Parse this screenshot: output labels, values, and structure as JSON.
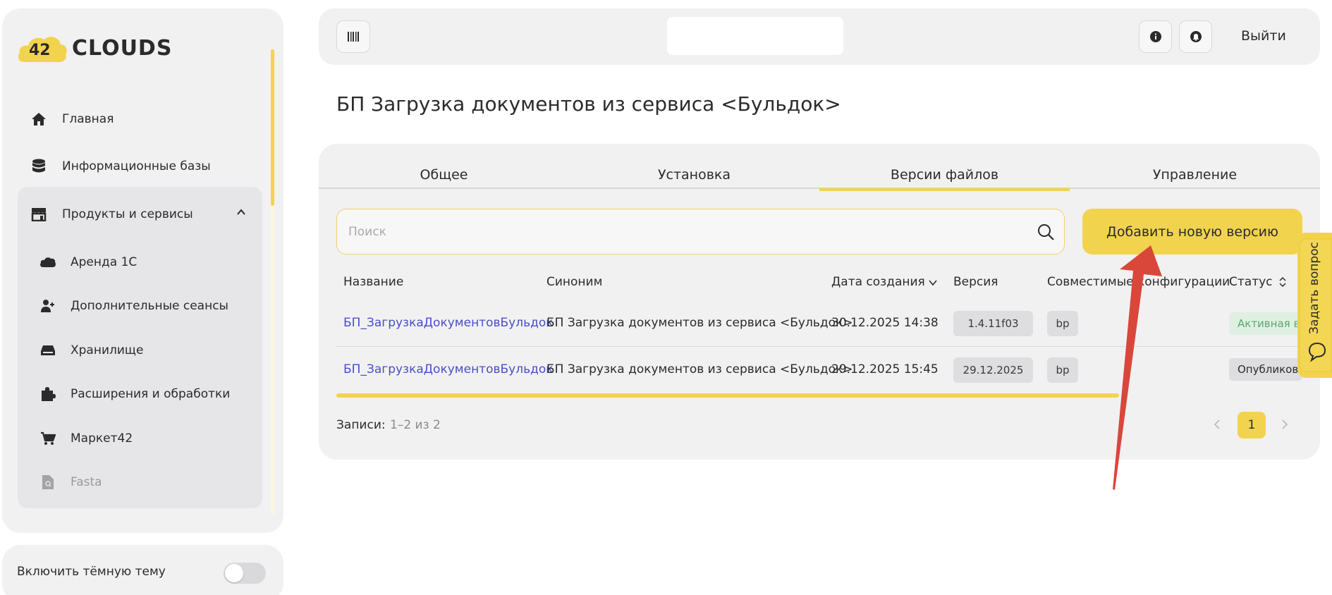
{
  "brand": {
    "logo_number": "42",
    "logo_text": "CLOUDS"
  },
  "sidebar": {
    "items": [
      {
        "label": "Главная",
        "icon": "home-icon"
      },
      {
        "label": "Информационные базы",
        "icon": "database-icon"
      },
      {
        "label": "Продукты и сервисы",
        "icon": "store-icon"
      }
    ],
    "sub_items": [
      {
        "label": "Аренда 1С",
        "icon": "cloud-icon"
      },
      {
        "label": "Дополнительные сеансы",
        "icon": "user-plus-icon"
      },
      {
        "label": "Хранилище",
        "icon": "storage-icon"
      },
      {
        "label": "Расширения и обработки",
        "icon": "puzzle-icon"
      },
      {
        "label": "Маркет42",
        "icon": "cart-icon"
      },
      {
        "label": "Fasta",
        "icon": "file-search-icon"
      }
    ],
    "theme_label": "Включить тёмную тему",
    "theme_enabled": false
  },
  "topbar": {
    "logout_label": "Выйти"
  },
  "page": {
    "title": "БП Загрузка документов из сервиса <Бульдок>"
  },
  "tabs": [
    {
      "label": "Общее",
      "active": false
    },
    {
      "label": "Установка",
      "active": false
    },
    {
      "label": "Версии файлов",
      "active": true
    },
    {
      "label": "Управление",
      "active": false
    }
  ],
  "search": {
    "placeholder": "Поиск",
    "value": ""
  },
  "add_button_label": "Добавить новую версию",
  "table": {
    "columns": [
      "Название",
      "Синоним",
      "Дата создания",
      "Версия",
      "Совместимые конфигурации",
      "Статус"
    ],
    "rows": [
      {
        "name": "БП_ЗагрузкаДокументовБульдок",
        "synonym": "БП Загрузка документов из сервиса <Бульдок>",
        "created": "30.12.2025 14:38",
        "version": "1.4.11f03",
        "config": "bp",
        "status": "Активная в"
      },
      {
        "name": "БП_ЗагрузкаДокументовБульдок",
        "synonym": "БП Загрузка документов из сервиса <Бульдок>",
        "created": "29.12.2025 15:45",
        "version": "29.12.2025",
        "config": "bp",
        "status": "Опубликов"
      }
    ]
  },
  "pagination": {
    "records_label": "Записи:",
    "records_value": "1–2 из 2",
    "current_page": "1"
  },
  "ask": {
    "label": "Задать вопрос"
  },
  "colors": {
    "accent": "#f2d34e",
    "link": "#4a4ec6",
    "panel": "#f1f1f2",
    "active_status_bg": "#dff0e3",
    "active_status_text": "#5aa86b",
    "arrow": "#d9473b"
  }
}
